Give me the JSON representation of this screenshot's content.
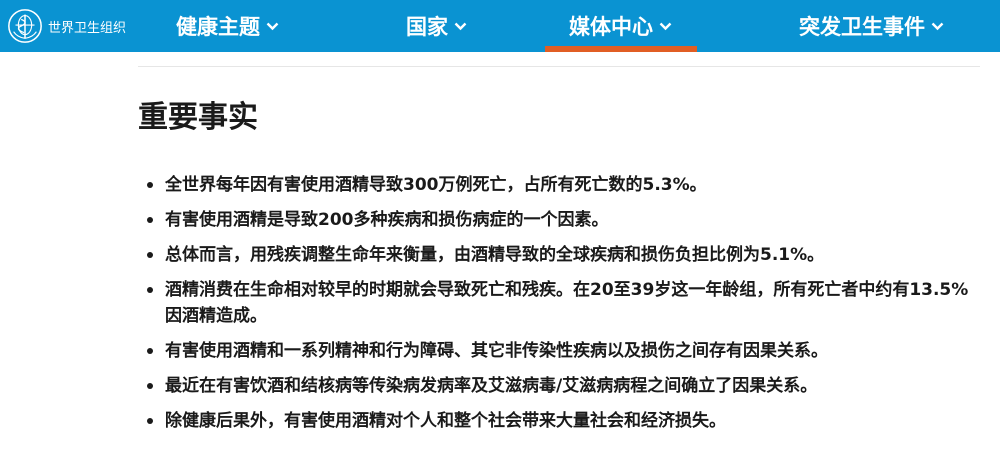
{
  "brand": {
    "logo_text": "世界卫生组织",
    "emblem_icon": "who-emblem-icon",
    "nav_color": "#0a93d2",
    "active_color": "#e15e24"
  },
  "nav": {
    "items": [
      {
        "label": "健康主题"
      },
      {
        "label": "国家"
      },
      {
        "label": "媒体中心"
      },
      {
        "label": "突发卫生事件"
      }
    ],
    "active": "媒体中心"
  },
  "main": {
    "heading": "重要事实",
    "facts": [
      "全世界每年因有害使用酒精导致300万例死亡，占所有死亡数的5.3%。",
      "有害使用酒精是导致200多种疾病和损伤病症的一个因素。",
      "总体而言，用残疾调整生命年来衡量，由酒精导致的全球疾病和损伤负担比例为5.1%。",
      "酒精消费在生命相对较早的时期就会导致死亡和残疾。在20至39岁这一年龄组，所有死亡者中约有13.5%因酒精造成。",
      "有害使用酒精和一系列精神和行为障碍、其它非传染性疾病以及损伤之间存有因果关系。",
      "最近在有害饮酒和结核病等传染病发病率及艾滋病毒/艾滋病病程之间确立了因果关系。",
      "除健康后果外，有害使用酒精对个人和整个社会带来大量社会和经济损失。"
    ]
  }
}
